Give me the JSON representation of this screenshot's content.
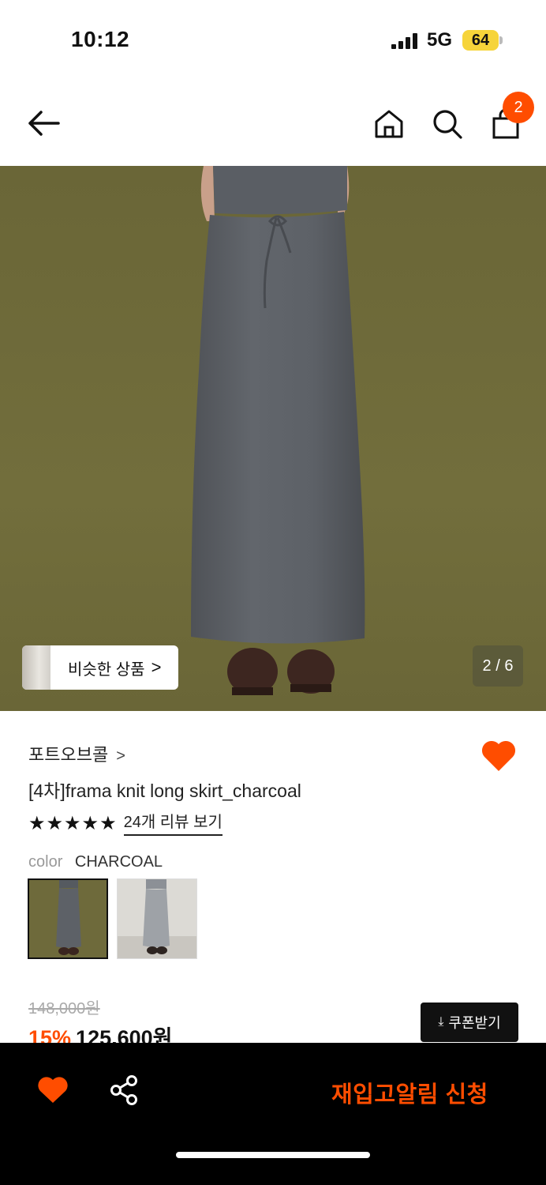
{
  "status_bar": {
    "time": "10:12",
    "network": "5G",
    "battery": "64"
  },
  "header": {
    "cart_count": "2"
  },
  "gallery": {
    "similar_label": "비슷한 상품",
    "similar_chevron": ">",
    "counter": "2 / 6"
  },
  "product": {
    "brand": "포트오브콜",
    "brand_chevron": ">",
    "name": "[4차]frama knit long skirt_charcoal",
    "stars": [
      "★",
      "★",
      "★",
      "★",
      "★"
    ],
    "review_link": "24개 리뷰 보기",
    "option_label": "color",
    "option_value": "CHARCOAL",
    "original_price": "148,000원",
    "discount": "15%",
    "price": "125,600원",
    "coupon_label": "쿠폰받기"
  },
  "bottom_bar": {
    "restock_label": "재입고알림 신청"
  },
  "colors": {
    "accent": "#ff4d00",
    "photo_bg": "#6f6b39",
    "skirt": "#5c6066"
  },
  "icons": [
    "back-icon",
    "home-icon",
    "search-icon",
    "bag-icon",
    "heart-icon",
    "share-icon",
    "download-icon"
  ]
}
